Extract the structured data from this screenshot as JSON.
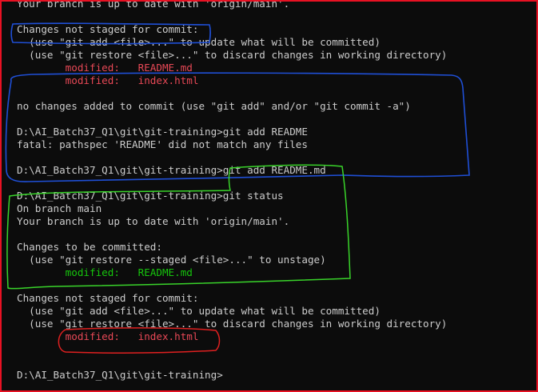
{
  "terminal": {
    "lines": [
      {
        "text": "Your branch is up to date with 'origin/main'.",
        "color": "default"
      },
      {
        "text": "",
        "color": "default"
      },
      {
        "text": "Changes not staged for commit:",
        "color": "default"
      },
      {
        "text": "  (use \"git add <file>...\" to update what will be committed)",
        "color": "default"
      },
      {
        "text": "  (use \"git restore <file>...\" to discard changes in working directory)",
        "color": "default"
      },
      {
        "text": "        modified:   README.md",
        "color": "red"
      },
      {
        "text": "        modified:   index.html",
        "color": "red"
      },
      {
        "text": "",
        "color": "default"
      },
      {
        "text": "no changes added to commit (use \"git add\" and/or \"git commit -a\")",
        "color": "default"
      },
      {
        "text": "",
        "color": "default"
      },
      {
        "text": "D:\\AI_Batch37_Q1\\git\\git-training>git add README",
        "color": "default"
      },
      {
        "text": "fatal: pathspec 'README' did not match any files",
        "color": "default"
      },
      {
        "text": "",
        "color": "default"
      },
      {
        "text": "D:\\AI_Batch37_Q1\\git\\git-training>git add README.md",
        "color": "default"
      },
      {
        "text": "",
        "color": "default"
      },
      {
        "text": "D:\\AI_Batch37_Q1\\git\\git-training>git status",
        "color": "default"
      },
      {
        "text": "On branch main",
        "color": "default"
      },
      {
        "text": "Your branch is up to date with 'origin/main'.",
        "color": "default"
      },
      {
        "text": "",
        "color": "default"
      },
      {
        "text": "Changes to be committed:",
        "color": "default"
      },
      {
        "text": "  (use \"git restore --staged <file>...\" to unstage)",
        "color": "default"
      },
      {
        "text": "        modified:   README.md",
        "color": "green"
      },
      {
        "text": "",
        "color": "default"
      },
      {
        "text": "Changes not staged for commit:",
        "color": "default"
      },
      {
        "text": "  (use \"git add <file>...\" to update what will be committed)",
        "color": "default"
      },
      {
        "text": "  (use \"git restore <file>...\" to discard changes in working directory)",
        "color": "default"
      },
      {
        "text": "        modified:   index.html",
        "color": "red"
      },
      {
        "text": "",
        "color": "default"
      },
      {
        "text": "",
        "color": "default"
      },
      {
        "text": "D:\\AI_Batch37_Q1\\git\\git-training>",
        "color": "default"
      }
    ]
  },
  "colors": {
    "background": "#0c0c0c",
    "foreground": "#cccccc",
    "modified_unstaged": "#e74856",
    "modified_staged": "#16c60c",
    "frame_border": "#e81123",
    "annotation_blue": "#1f4fd6",
    "annotation_green": "#39d42a",
    "annotation_red": "#e02020"
  },
  "annotations": [
    {
      "kind": "blue-box",
      "label": ""
    },
    {
      "kind": "blue-box",
      "label": ""
    },
    {
      "kind": "green-box",
      "label": ""
    },
    {
      "kind": "red-box",
      "label": ""
    }
  ]
}
